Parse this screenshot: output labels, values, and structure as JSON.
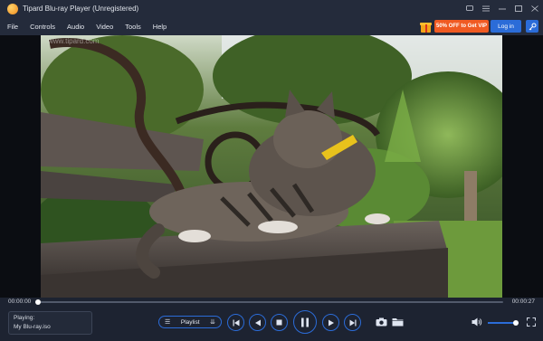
{
  "window": {
    "title": "Tipard Blu-ray Player (Unregistered)",
    "controls": [
      "feedback-icon",
      "menu-icon",
      "minimize-icon",
      "maximize-icon",
      "close-icon"
    ]
  },
  "menu": {
    "items": [
      {
        "label": "File"
      },
      {
        "label": "Controls"
      },
      {
        "label": "Audio"
      },
      {
        "label": "Video"
      },
      {
        "label": "Tools"
      },
      {
        "label": "Help"
      }
    ],
    "promo_label": "50% OFF to Get VIP",
    "login_label": "Log in",
    "key_icon": "key-icon"
  },
  "video": {
    "watermark": "www.tipard.com"
  },
  "progress": {
    "current_time": "00:00:00",
    "total_time": "00:00:27",
    "fraction": 0.0
  },
  "now_playing": {
    "label": "Playing:",
    "file": "My Blu-ray.iso"
  },
  "playlist": {
    "label": "Playlist"
  },
  "volume": {
    "level": 0.9
  },
  "colors": {
    "accent": "#2b6cd8",
    "promo": "#f05a22",
    "background": "#1d2331",
    "bar": "#242b3b"
  }
}
